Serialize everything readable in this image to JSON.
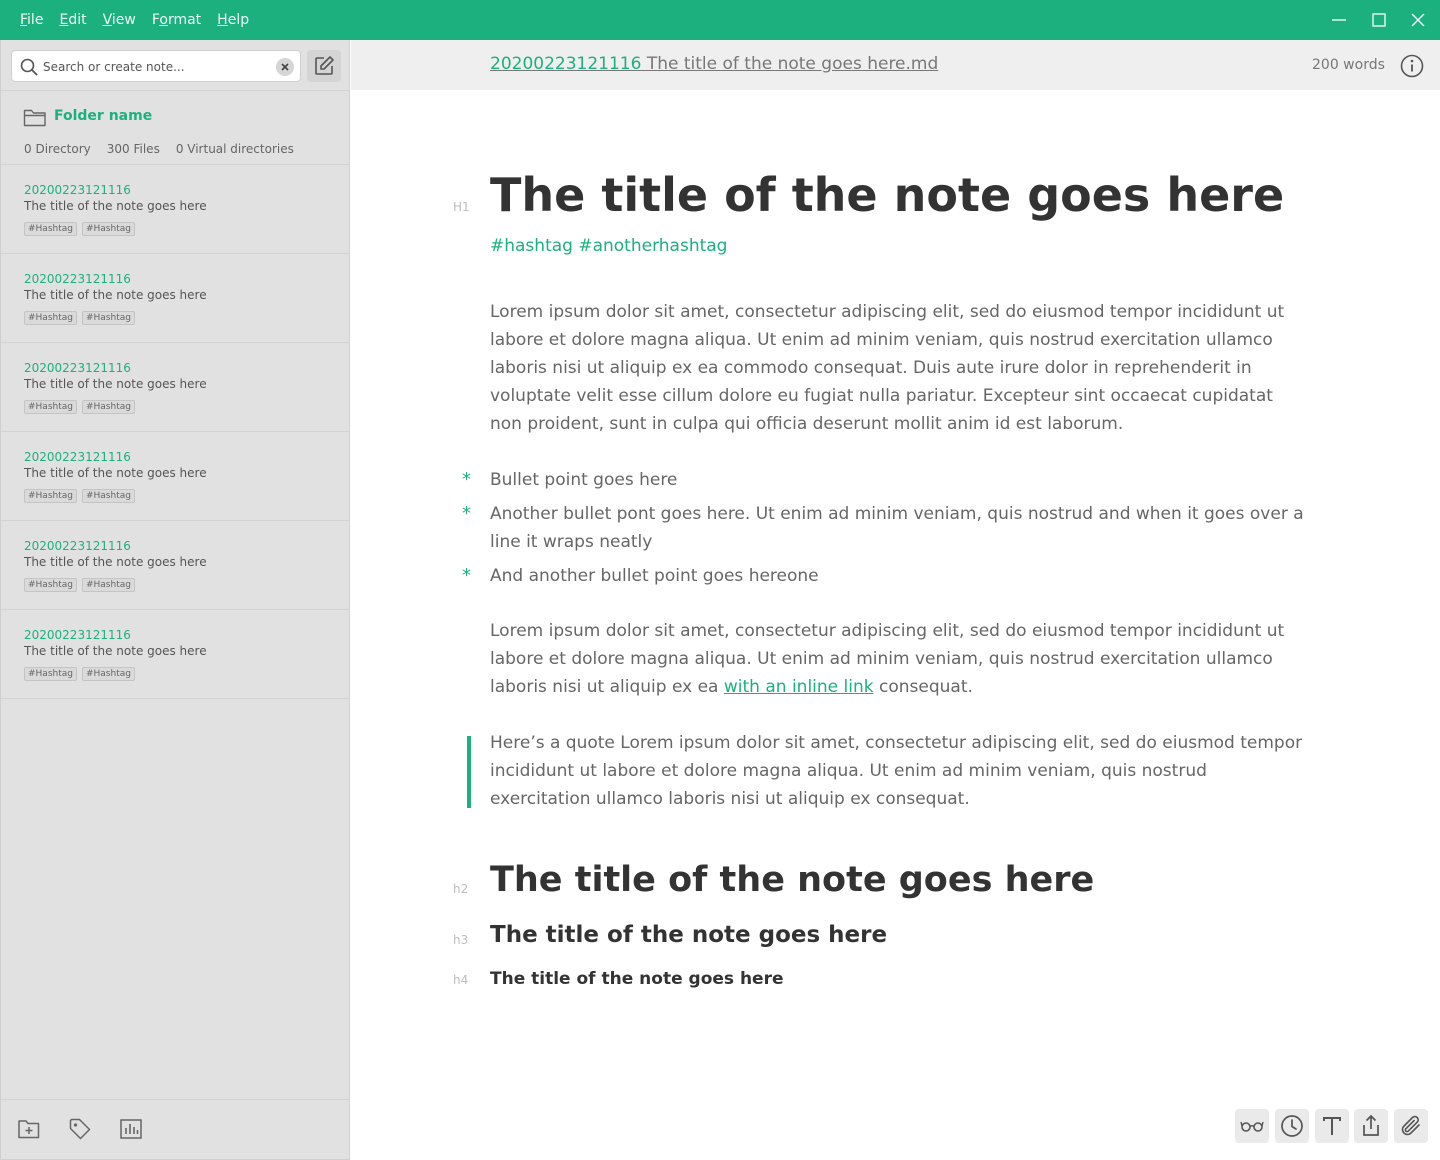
{
  "colors": {
    "accent": "#1db07f",
    "titlebar": "#1db07f",
    "sidebar_bg": "#e1e1e1",
    "header_bg": "#efefef"
  },
  "menu": [
    {
      "mnemonic": "F",
      "rest": "ile"
    },
    {
      "mnemonic": "E",
      "rest": "dit"
    },
    {
      "mnemonic": "V",
      "rest": "iew"
    },
    {
      "pre": "F",
      "mnemonic": "o",
      "rest": "rmat"
    },
    {
      "mnemonic": "H",
      "rest": "elp"
    }
  ],
  "window_controls": [
    "minimize-icon",
    "maximize-icon",
    "close-icon"
  ],
  "search": {
    "placeholder": "Search or create note...",
    "value": ""
  },
  "folder": {
    "name": "Folder name",
    "stats": [
      "0 Directory",
      "300 Files",
      "0 Virtual directories"
    ]
  },
  "notes": [
    {
      "id": "20200223121116",
      "title": "The title of the note goes here",
      "tags": [
        "#Hashtag",
        "#Hashtag"
      ]
    },
    {
      "id": "20200223121116",
      "title": "The title of the note goes here",
      "tags": [
        "#Hashtag",
        "#Hashtag"
      ]
    },
    {
      "id": "20200223121116",
      "title": "The title of the note goes here",
      "tags": [
        "#Hashtag",
        "#Hashtag"
      ]
    },
    {
      "id": "20200223121116",
      "title": "The title of the note goes here",
      "tags": [
        "#Hashtag",
        "#Hashtag"
      ]
    },
    {
      "id": "20200223121116",
      "title": "The title of the note goes here",
      "tags": [
        "#Hashtag",
        "#Hashtag"
      ]
    },
    {
      "id": "20200223121116",
      "title": "The title of the note goes here",
      "tags": [
        "#Hashtag",
        "#Hashtag"
      ]
    }
  ],
  "sidebar_footer": [
    "new-folder-icon",
    "tag-icon",
    "stats-icon"
  ],
  "editor_header": {
    "file_id": "20200223121116",
    "file_title": " The title of the note goes here.md",
    "word_count": "200 words"
  },
  "document": {
    "h1_marker": "H1",
    "h1": "The title of the note goes here",
    "hashtags": "#hashtag #anotherhashtag",
    "paragraph1": "Lorem ipsum dolor sit amet, consectetur adipiscing elit, sed do eiusmod tempor incididunt ut labore et dolore magna aliqua. Ut enim ad minim veniam, quis nostrud exercitation ullamco laboris nisi ut aliquip ex ea commodo consequat. Duis aute irure dolor in reprehenderit in voluptate velit esse cillum dolore eu fugiat nulla pariatur. Excepteur sint occaecat cupidatat non proident, sunt in culpa qui officia deserunt mollit anim id est laborum.",
    "bullet_marker": "*",
    "bullets": [
      "Bullet point goes here",
      "Another bullet pont goes here. Ut enim ad minim veniam, quis nostrud and when it goes over a line it wraps neatly",
      "And another bullet point goes hereone"
    ],
    "paragraph2_before": "Lorem ipsum dolor sit amet, consectetur adipiscing elit, sed do eiusmod tempor incididunt ut labore et dolore magna aliqua. Ut enim ad minim veniam, quis nostrud exercitation ullamco laboris nisi ut aliquip ex ea ",
    "paragraph2_link": "with an inline link",
    "paragraph2_after": " consequat.",
    "quote": "Here’s a quote Lorem ipsum dolor sit amet, consectetur adipiscing elit, sed do eiusmod tempor incididunt ut labore et dolore magna aliqua. Ut enim ad minim veniam, quis nostrud exercitation ullamco laboris nisi ut aliquip ex consequat.",
    "h2_marker": "h2",
    "h2": "The title of the note goes here",
    "h3_marker": "h3",
    "h3": "The title of the note goes here",
    "h4_marker": "h4",
    "h4": "The title of the note goes here"
  },
  "editor_toolbar": [
    "glasses-icon",
    "clock-icon",
    "text-format-icon",
    "share-icon",
    "attachment-icon"
  ]
}
